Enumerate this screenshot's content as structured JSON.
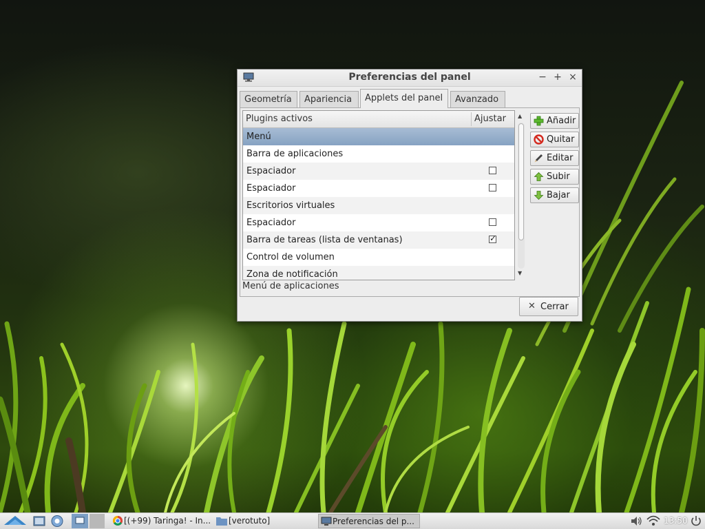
{
  "window": {
    "title": "Preferencias del panel",
    "controls": {
      "minimize": "−",
      "maximize": "+",
      "close": "×"
    }
  },
  "tabs": [
    {
      "label": "Geometría",
      "active": false
    },
    {
      "label": "Apariencia",
      "active": false
    },
    {
      "label": "Applets del panel",
      "active": true
    },
    {
      "label": "Avanzado",
      "active": false
    }
  ],
  "plugin_list": {
    "columns": [
      "Plugins activos",
      "Ajustar"
    ],
    "rows": [
      {
        "name": "Menú",
        "selected": true,
        "expand": null
      },
      {
        "name": "Barra de aplicaciones",
        "selected": false,
        "expand": null
      },
      {
        "name": "Espaciador",
        "selected": false,
        "expand": false
      },
      {
        "name": "Espaciador",
        "selected": false,
        "expand": false
      },
      {
        "name": "Escritorios virtuales",
        "selected": false,
        "expand": null
      },
      {
        "name": "Espaciador",
        "selected": false,
        "expand": false
      },
      {
        "name": "Barra de tareas (lista de ventanas)",
        "selected": false,
        "expand": true
      },
      {
        "name": "Control de volumen",
        "selected": false,
        "expand": null
      },
      {
        "name": "Zona de notificación",
        "selected": false,
        "expand": null
      }
    ],
    "description": "Menú de aplicaciones"
  },
  "side_buttons": [
    {
      "label": "Añadir",
      "icon": "add-icon"
    },
    {
      "label": "Quitar",
      "icon": "remove-icon"
    },
    {
      "label": "Editar",
      "icon": "edit-icon"
    },
    {
      "label": "Subir",
      "icon": "up-arrow-icon"
    },
    {
      "label": "Bajar",
      "icon": "down-arrow-icon"
    }
  ],
  "close_button": {
    "label": "Cerrar",
    "icon": "close-icon"
  },
  "taskbar": {
    "tasks": [
      {
        "label": "[(+99) Taringa! - In...",
        "icon": "chrome-icon",
        "active": false
      },
      {
        "label": "[verotuto]",
        "icon": "folder-icon",
        "active": false
      },
      {
        "label": "Preferencias del p...",
        "icon": "monitor-icon",
        "active": true
      }
    ],
    "clock": "13:50"
  },
  "colors": {
    "selection": "#8ea8c6",
    "window_bg": "#ededed",
    "add_green": "#5cb82e",
    "remove_red": "#d42a1f",
    "arrow_green": "#7fc141"
  }
}
